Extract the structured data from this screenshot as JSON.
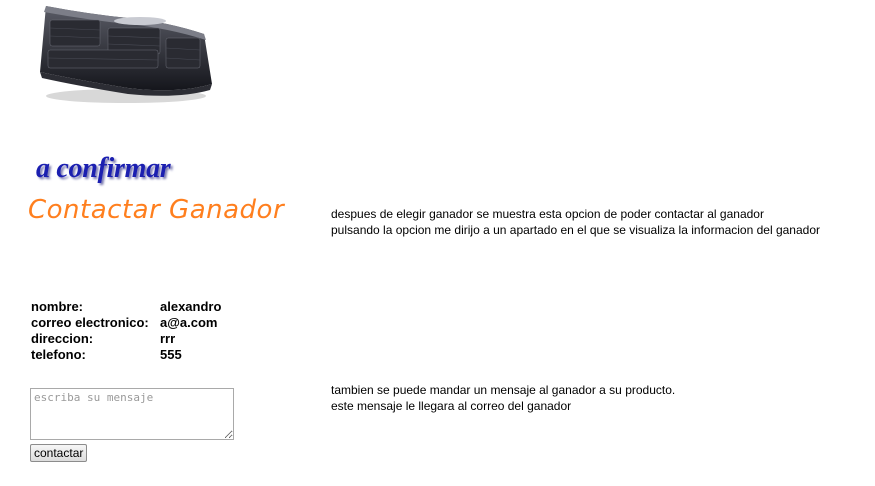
{
  "images": {
    "keyboard_icon": "keyboard-icon"
  },
  "headings": {
    "confirm_title": "a confirmar",
    "contact_title": "Contactar Ganador"
  },
  "descriptions": {
    "contact_line_1": "despues de elegir ganador se muestra esta opcion de poder contactar al ganador",
    "contact_line_2": "pulsando la opcion me dirijo a un apartado en el que se visualiza la informacion del ganador",
    "message_line_1": "tambien se puede mandar un mensaje al ganador a su producto.",
    "message_line_2": "este mensaje le llegara al correo del ganador"
  },
  "winner_info": [
    {
      "label": "nombre:",
      "value": "alexandro"
    },
    {
      "label": "correo electronico:",
      "value": "a@a.com"
    },
    {
      "label": "direccion:",
      "value": "rrr"
    },
    {
      "label": "telefono:",
      "value": "555"
    }
  ],
  "message_form": {
    "placeholder": "escriba su mensaje",
    "value": "",
    "button_label": "contactar"
  },
  "colors": {
    "confirm_title": "#1b1fb0",
    "contact_title": "#ff7f1e"
  }
}
